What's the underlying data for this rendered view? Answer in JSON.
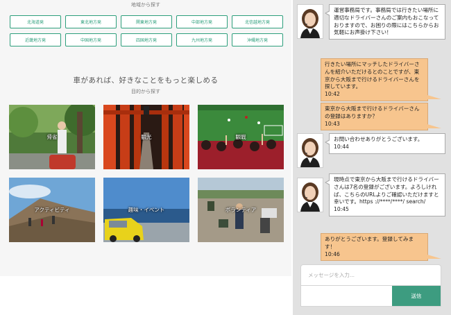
{
  "region_section": {
    "label": "地域から探す",
    "buttons": [
      "北海道発",
      "東北地方発",
      "関東地方発",
      "中部地方発",
      "北信越地方発",
      "近畿地方発",
      "中国地方発",
      "四国地方発",
      "九州地方発",
      "沖縄地方発"
    ]
  },
  "purpose_section": {
    "heading": "車があれば、好きなことをもっと楽しめる",
    "sub_label": "目的から探す",
    "tiles": [
      "帰省",
      "観光",
      "観戦",
      "アクティビティ",
      "趣味・イベント",
      "ボランティア"
    ]
  },
  "chat": {
    "messages": [
      {
        "from": "bot",
        "text": "運営事務局です。事務局では行きたい場所に適切なドライバーさんのご案内もおこなっておりますので、お困りの際にはこちらからお気軽にお声掛け下さい！",
        "time": ""
      },
      {
        "from": "user",
        "text": "行きたい場所にマッチしたドライバーさんを紹介いただけるとのことですが、東京から大阪まで行けるドライバーさんを探しています。",
        "time": "10:42"
      },
      {
        "from": "user",
        "text": "東京から大阪まで行けるドライバーさんの登録はありますか？",
        "time": "10:43"
      },
      {
        "from": "bot",
        "text": "お問い合わせありがとうございます。",
        "time": "10:44"
      },
      {
        "from": "bot",
        "text": "現時点で東京から大阪まで行けるドライバーさんは7名の登録がございます。よろしければ、こちらのURLよりご確認いただけますと幸いです。https ://****/****/ search/",
        "time": "10:45"
      },
      {
        "from": "user",
        "text": "ありがとうございます。登録してみます！",
        "time": "10:46"
      }
    ],
    "input_placeholder": "メッセージを入力...",
    "send_label": "送信"
  },
  "colors": {
    "accent": "#2c9e7b",
    "send_button": "#3d9c80",
    "user_bubble": "#f7c58e",
    "chat_panel": "#e1e1e1"
  }
}
